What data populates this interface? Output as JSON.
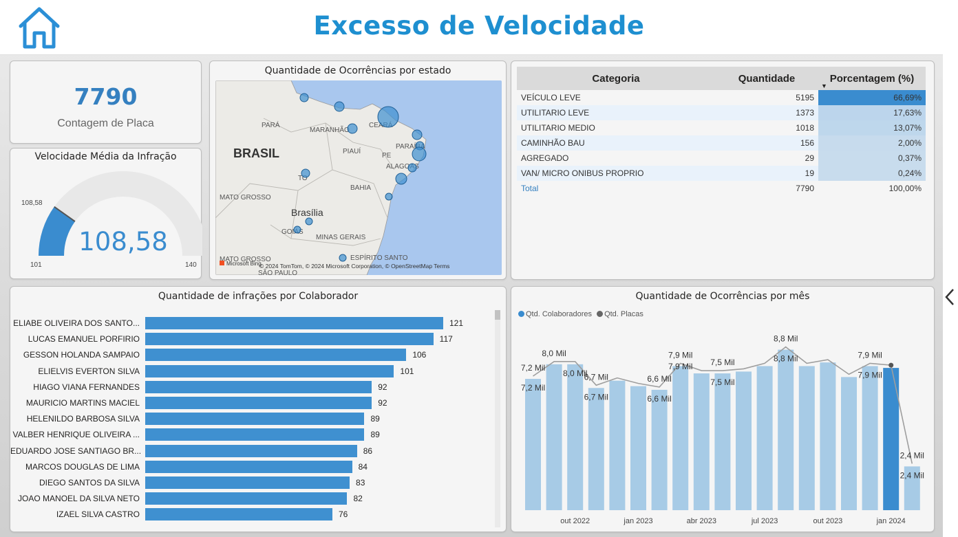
{
  "header": {
    "title": "Excesso de Velocidade"
  },
  "icons": {
    "home": "home-icon",
    "collapse": "chevron-left-icon"
  },
  "colors": {
    "accent": "#1e8fd0",
    "bar": "#3f90d0",
    "column": "#a7cbe6",
    "column_highlight": "#3a8ccf",
    "line": "#9e9e9e"
  },
  "kpi": {
    "value": "7790",
    "label": "Contagem de Placa"
  },
  "gauge": {
    "title": "Velocidade Média da Infração",
    "value": "108,58",
    "current_label": "108,58",
    "min": "101",
    "max": "140",
    "fraction": 0.197
  },
  "map": {
    "title": "Quantidade de Ocorrências por estado",
    "labels": [
      "PARÁ",
      "MARANHÃO",
      "CEARÁ",
      "BRASIL",
      "PIAUÍ",
      "PARAÍBA",
      "PE",
      "ALAGOAS",
      "TO",
      "BAHIA",
      "MATO GROSSO",
      "Brasília",
      "GOIÁS",
      "MINAS GERAIS",
      "MATO GROSSO",
      "ESPÍRITO SANTO",
      "SÃO PAULO"
    ],
    "attribution": "© 2024 TomTom, © 2024 Microsoft Corporation, © OpenStreetMap  Terms",
    "provider": "Microsoft Bing"
  },
  "table": {
    "columns": [
      "Categoria",
      "Quantidade",
      "Porcentagem (%)"
    ],
    "sort_indicator": "▼",
    "rows": [
      {
        "categoria": "VEÍCULO LEVE",
        "quantidade": "5195",
        "porcentagem": "66,69%",
        "share": 0.6669
      },
      {
        "categoria": "UTILITARIO LEVE",
        "quantidade": "1373",
        "porcentagem": "17,63%",
        "share": 0.1763
      },
      {
        "categoria": "UTILITARIO MEDIO",
        "quantidade": "1018",
        "porcentagem": "13,07%",
        "share": 0.1307
      },
      {
        "categoria": "CAMINHÃO BAU",
        "quantidade": "156",
        "porcentagem": "2,00%",
        "share": 0.02
      },
      {
        "categoria": "AGREGADO",
        "quantidade": "29",
        "porcentagem": "0,37%",
        "share": 0.0037
      },
      {
        "categoria": "VAN/ MICRO ONIBUS PROPRIO",
        "quantidade": "19",
        "porcentagem": "0,24%",
        "share": 0.0024
      }
    ],
    "total": {
      "label": "Total",
      "quantidade": "7790",
      "porcentagem": "100,00%"
    }
  },
  "bar_chart_title": "Quantidade de infrações por Colaborador",
  "column_chart_title": "Quantidade de Ocorrências por mês",
  "chart_data": [
    {
      "type": "bar",
      "title": "Quantidade de infrações por Colaborador",
      "categories": [
        "ELIABE OLIVEIRA DOS SANTO...",
        "LUCAS EMANUEL PORFIRIO",
        "GESSON HOLANDA SAMPAIO",
        "ELIELVIS EVERTON SILVA",
        "HIAGO VIANA FERNANDES",
        "MAURICIO MARTINS MACIEL",
        "HELENILDO BARBOSA SILVA",
        "VALBER HENRIQUE OLIVEIRA ...",
        "EDUARDO JOSE SANTIAGO BR...",
        "MARCOS DOUGLAS DE LIMA",
        "DIEGO SANTOS DA SILVA",
        "JOAO MANOEL DA SILVA NETO",
        "IZAEL SILVA CASTRO"
      ],
      "values": [
        121,
        117,
        106,
        101,
        92,
        92,
        89,
        89,
        86,
        84,
        83,
        82,
        76
      ],
      "xlim": [
        0,
        125
      ]
    },
    {
      "type": "bar",
      "title": "Quantidade de Ocorrências por mês",
      "legend": [
        "Qtd. Colaboradores",
        "Qtd. Placas"
      ],
      "x_tick_labels": [
        "out 2022",
        "jan 2023",
        "abr 2023",
        "jul 2023",
        "out 2023",
        "jan 2024"
      ],
      "series": [
        {
          "name": "Qtd. Colaboradores",
          "type": "bar",
          "values": [
            7.2,
            8.0,
            8.0,
            6.7,
            7.1,
            6.8,
            6.6,
            7.9,
            7.5,
            7.5,
            7.6,
            7.9,
            8.8,
            7.9,
            8.1,
            7.3,
            7.9,
            7.8,
            2.4
          ]
        },
        {
          "name": "Qtd. Placas",
          "type": "line",
          "values": [
            7.2,
            8.0,
            8.0,
            6.7,
            7.1,
            6.8,
            6.6,
            7.9,
            7.5,
            7.5,
            7.6,
            7.9,
            8.8,
            7.9,
            8.1,
            7.3,
            7.9,
            7.8,
            2.4
          ]
        }
      ],
      "highlight_index": 17,
      "data_labels": [
        {
          "i": 0,
          "bar": "7,2 Mil",
          "line": "7,2 Mil"
        },
        {
          "i": 1,
          "line": "8,0 Mil"
        },
        {
          "i": 2,
          "bar": "8,0 Mil"
        },
        {
          "i": 3,
          "bar": "6,7 Mil",
          "line": "6,7 Mil"
        },
        {
          "i": 6,
          "bar": "6,6 Mil",
          "line": "6,6 Mil",
          "bar2": "7,9 Mil"
        },
        {
          "i": 7,
          "line": "7,9 Mil"
        },
        {
          "i": 9,
          "bar": "7,5 Mil",
          "line": "7,5 Mil"
        },
        {
          "i": 12,
          "bar": "8,8 Mil",
          "line": "8,8 Mil"
        },
        {
          "i": 16,
          "bar": "7,9 Mil",
          "line": "7,9 Mil"
        },
        {
          "i": 18,
          "bar": "2,4 Mil",
          "line": "2,4 Mil"
        }
      ],
      "unit": "Mil",
      "ylim": [
        0,
        9.5
      ]
    }
  ]
}
